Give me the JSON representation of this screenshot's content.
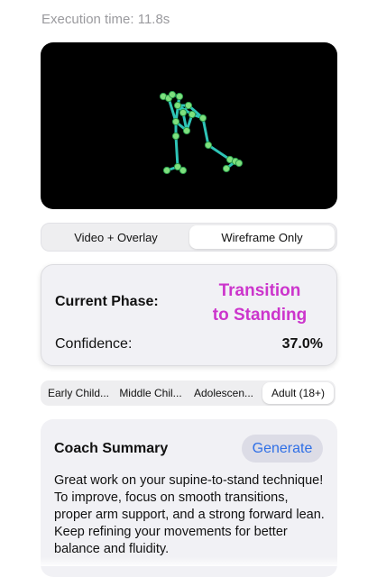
{
  "execution": {
    "text": "Execution time: 11.8s"
  },
  "video": {
    "bone_color": "#2ec4b6",
    "joint_color": "#7ee07e"
  },
  "view_mode": {
    "options": [
      "Video + Overlay",
      "Wireframe Only"
    ],
    "selected": "Wireframe Only"
  },
  "phase": {
    "label": "Current Phase:",
    "value_line1": "Transition",
    "value_line2": "to Standing",
    "value_color": "#cc35cc",
    "confidence_label": "Confidence:",
    "confidence_value": "37.0%"
  },
  "age_groups": {
    "options": [
      "Early Child...",
      "Middle Chil...",
      "Adolescen...",
      "Adult (18+)"
    ],
    "selected": "Adult (18+)"
  },
  "coach": {
    "title": "Coach Summary",
    "button": "Generate",
    "text": "Great work on your supine-to-stand technique! To improve, focus on smooth transitions, proper arm support, and a strong forward lean. Keep refining your movements for better balance and fluidity."
  }
}
